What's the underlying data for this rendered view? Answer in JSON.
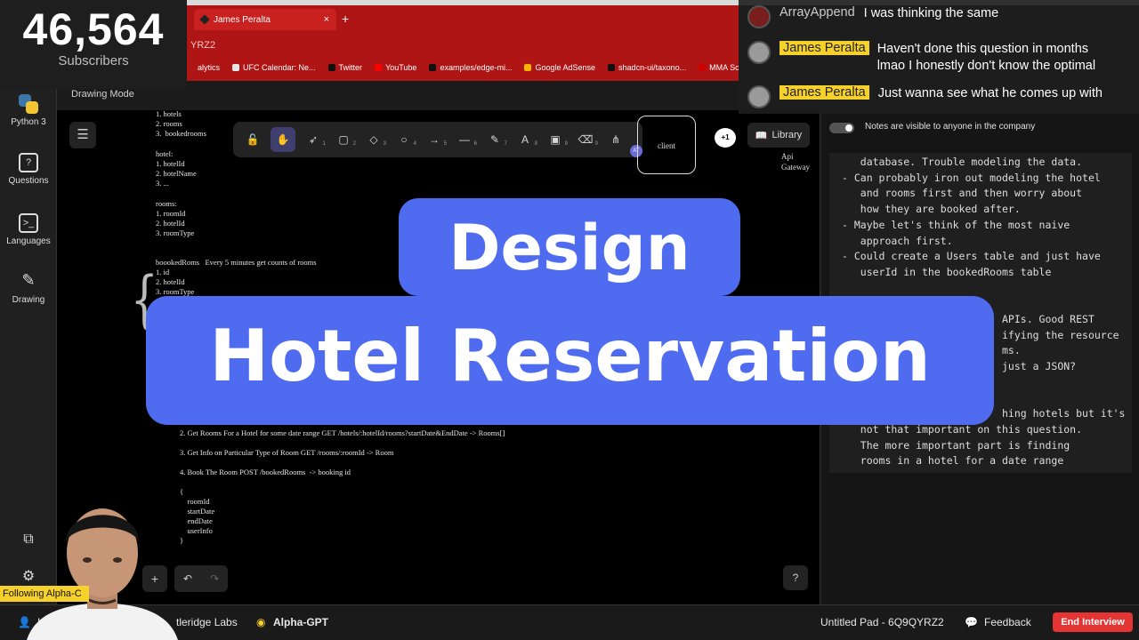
{
  "overlay": {
    "subscriber_count": "46,564",
    "subscriber_label": "Subscribers",
    "title": "Design",
    "subtitle": "Hotel Reservation",
    "following_banner": "Following Alpha-C"
  },
  "browser": {
    "tab_title": "James Peralta",
    "tab_close": "×",
    "new_tab": "+",
    "address": "YRZ2",
    "bookmarks": [
      {
        "label": "alytics",
        "color": "#b01515"
      },
      {
        "label": "UFC Calendar: Ne...",
        "color": "#e6e6e6"
      },
      {
        "label": "Twitter",
        "color": "#111111"
      },
      {
        "label": "YouTube",
        "color": "#ff0000"
      },
      {
        "label": "examples/edge-mi...",
        "color": "#111111"
      },
      {
        "label": "Google AdSense",
        "color": "#f4b400"
      },
      {
        "label": "shadcn-ui/taxono...",
        "color": "#111111"
      },
      {
        "label": "MMA Schedule -",
        "color": "#d00000"
      }
    ]
  },
  "sidebar": {
    "items": [
      {
        "label": "Python 3",
        "icon": "python-icon"
      },
      {
        "label": "Questions",
        "icon": "question-icon"
      },
      {
        "label": "Languages",
        "icon": "terminal-icon"
      },
      {
        "label": "Drawing",
        "icon": "pen-icon"
      }
    ]
  },
  "canvas": {
    "mode_label": "Drawing Mode",
    "library_label": "Library",
    "client_label": "client",
    "collab_count": "+1",
    "api_gateway": "Api\nGateway",
    "at_badge": "AT",
    "toolbar": [
      {
        "name": "lock-tool",
        "glyph": "🔓",
        "key": ""
      },
      {
        "name": "hand-tool",
        "glyph": "✋",
        "key": ""
      },
      {
        "name": "select-tool",
        "glyph": "➶",
        "key": "1"
      },
      {
        "name": "rectangle-tool",
        "glyph": "▢",
        "key": "2"
      },
      {
        "name": "diamond-tool",
        "glyph": "◇",
        "key": "3"
      },
      {
        "name": "ellipse-tool",
        "glyph": "○",
        "key": "4"
      },
      {
        "name": "arrow-tool",
        "glyph": "→",
        "key": "5"
      },
      {
        "name": "line-tool",
        "glyph": "—",
        "key": "6"
      },
      {
        "name": "pencil-tool",
        "glyph": "✎",
        "key": "7"
      },
      {
        "name": "text-tool",
        "glyph": "A",
        "key": "8"
      },
      {
        "name": "image-tool",
        "glyph": "▣",
        "key": "9"
      },
      {
        "name": "eraser-tool",
        "glyph": "⌫",
        "key": "0"
      },
      {
        "name": "shapes-tool",
        "glyph": "⋔",
        "key": ""
      }
    ],
    "entities_text": "1. hotels\n2. rooms\n3.  bookedrooms",
    "hotel_text": "hotel:\n1. hotelId\n2. hotelName\n3. ...",
    "rooms_text": "rooms:\n1. roomId\n2. hotelId\n3. roomType",
    "booked_text": "boookedRoms   Every 5 minutes get counts of rooms\n1. id\n2. hotelId\n3. roomType",
    "api_text": "2. Get Rooms For a Hotel for some date range GET /hotels/:hotelId/rooms?startDate&EndDate -> Rooms[]\n\n3. Get Info on Particular Type of Room GET /rooms/:roomId -> Room\n\n4. Book The Room POST /bookedRooms  -> booking id\n\n{\n    roomId\n    startDate\n    endDate\n    userInfo\n}"
  },
  "notes": {
    "visibility_label": "Notes are visible to anyone in the company",
    "text": "   database. Trouble modeling the data.\n- Can probably iron out modeling the hotel\n   and rooms first and then worry about\n   how they are booked after.\n- Maybe let's think of the most naive\n   approach first.\n- Could create a Users table and just have\n   userId in the bookedRooms table\n\n\n                          APIs. Good REST\n                          ifying the resource\n                          ms.\n                          just a JSON?\n\n\n                          hing hotels but it's\n   not that important on this question.\n   The more important part is finding\n   rooms in a hotel for a date range"
  },
  "chat": [
    {
      "user": "ArrayAppend",
      "highlight": false,
      "message": "I was thinking the same"
    },
    {
      "user": "James Peralta",
      "highlight": true,
      "message": "Haven't done this question in months\nlmao I honestly don't know the optimal"
    },
    {
      "user": "James Peralta",
      "highlight": true,
      "message": "Just wanna see what he comes up with"
    }
  ],
  "bottom": {
    "left_label": "In",
    "company": "tleridge Labs",
    "alpha": "Alpha-GPT",
    "pad_name": "Untitled Pad - 6Q9QYRZ2",
    "feedback": "Feedback",
    "end_interview": "End Interview"
  }
}
